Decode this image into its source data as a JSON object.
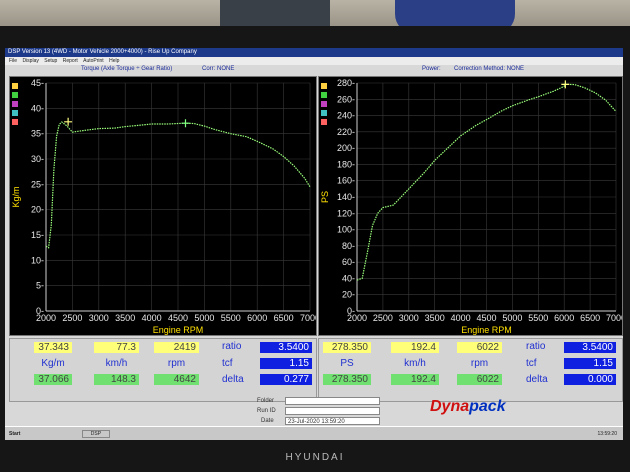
{
  "window": {
    "title": "DSP Version 13 (4WD - Motor Vehicle 2000+4000) - Rise Up Company",
    "menu": [
      "File",
      "Display",
      "Setup",
      "Report",
      "AutoPrint",
      "Help"
    ]
  },
  "left_chart": {
    "header_title": "Torque (Axle Torque ÷ Gear Ratio)",
    "header_corr": "Corr: NONE"
  },
  "right_chart": {
    "header_title": "Power:",
    "header_corr": "Correction Method: NONE"
  },
  "chart_data": [
    {
      "type": "line",
      "xlabel": "Engine RPM",
      "ylabel": "Kg/m",
      "xlim": [
        2000,
        7000
      ],
      "ylim": [
        0,
        45
      ],
      "x_ticks": [
        "2000",
        "2500",
        "3000",
        "3500",
        "4000",
        "4500",
        "5000",
        "5500",
        "6000",
        "6500",
        "7000"
      ],
      "y_ticks": [
        "0",
        "5",
        "10",
        "15",
        "20",
        "25",
        "30",
        "35",
        "40",
        "45"
      ],
      "grid": true,
      "series": [
        {
          "color": "#9aff7a",
          "x": [
            2000,
            2050,
            2100,
            2150,
            2200,
            2250,
            2300,
            2400,
            2500,
            2700,
            3000,
            3300,
            3500,
            3800,
            4000,
            4300,
            4500,
            4642,
            4800,
            5000,
            5200,
            5500,
            5800,
            6000,
            6300,
            6500,
            6700,
            6900,
            7000
          ],
          "y": [
            12.8,
            12.5,
            17,
            28,
            34.5,
            36.8,
            37.3,
            36.5,
            35.3,
            35.6,
            36.0,
            36.1,
            36.4,
            36.7,
            36.9,
            36.9,
            37.0,
            37.07,
            37.0,
            36.5,
            35.8,
            35.0,
            34.4,
            33.5,
            32.0,
            30.5,
            28.6,
            26.2,
            24.5
          ]
        }
      ],
      "markers": [
        {
          "x": 2419,
          "y": 37.343
        },
        {
          "x": 4642,
          "y": 37.066
        }
      ]
    },
    {
      "type": "line",
      "xlabel": "Engine RPM",
      "ylabel": "PS",
      "xlim": [
        2000,
        7000
      ],
      "ylim": [
        0,
        280
      ],
      "x_ticks": [
        "2000",
        "2500",
        "3000",
        "3500",
        "4000",
        "4500",
        "5000",
        "5500",
        "6000",
        "6500",
        "7000"
      ],
      "y_ticks": [
        "0",
        "20",
        "40",
        "60",
        "80",
        "100",
        "120",
        "140",
        "160",
        "180",
        "200",
        "220",
        "240",
        "260",
        "280"
      ],
      "grid": true,
      "series": [
        {
          "color": "#9aff7a",
          "x": [
            2000,
            2100,
            2200,
            2300,
            2400,
            2500,
            2700,
            3000,
            3300,
            3500,
            3800,
            4000,
            4300,
            4500,
            4800,
            5000,
            5300,
            5500,
            5800,
            6000,
            6022,
            6200,
            6400,
            6600,
            6800,
            7000
          ],
          "y": [
            38,
            40,
            72,
            105,
            120,
            127,
            130,
            150,
            170,
            185,
            203,
            215,
            228,
            235,
            246,
            252,
            259,
            263,
            270,
            276,
            278.35,
            278,
            274,
            268,
            259,
            245
          ]
        }
      ],
      "markers": [
        {
          "x": 6022,
          "y": 278.35
        }
      ]
    }
  ],
  "left_data": {
    "top": [
      "37.343",
      "77.3",
      "2419"
    ],
    "units": [
      "Kg/m",
      "km/h",
      "rpm"
    ],
    "bottom": [
      "37.066",
      "148.3",
      "4642"
    ],
    "side_labels": [
      "ratio",
      "tcf",
      "delta"
    ],
    "side_values": [
      "3.5400",
      "1.15",
      "0.277"
    ]
  },
  "right_data": {
    "top": [
      "278.350",
      "192.4",
      "6022"
    ],
    "units": [
      "PS",
      "km/h",
      "rpm"
    ],
    "bottom": [
      "278.350",
      "192.4",
      "6022"
    ],
    "side_labels": [
      "ratio",
      "tcf",
      "delta"
    ],
    "side_values": [
      "3.5400",
      "1.15",
      "0.000"
    ]
  },
  "info": {
    "folder_label": "Folder",
    "runid_label": "Run ID",
    "date_label": "Date",
    "date_value": "23-Jul-2020 13:59:20"
  },
  "logo": {
    "part1": "Dyna",
    "part2": "pack"
  },
  "taskbar": {
    "start": "Start",
    "app": "DSP",
    "clock": "13:59:20"
  },
  "monitor_brand": "HYUNDAI",
  "colors": {
    "curve": "#9aff7a",
    "axis": "#e8e8e8",
    "grid": "#3a3a3a",
    "yellow_cell": "#ffff78",
    "green_cell": "#70e070",
    "blue_cell": "#1020e0"
  }
}
